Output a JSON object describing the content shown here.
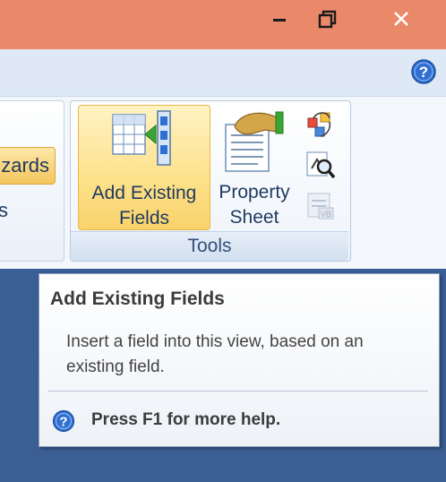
{
  "window": {
    "minimize_icon": "minimize-icon",
    "maximize_icon": "restore-icon",
    "close_icon": "close-icon",
    "titlebar_color": "#e9896a"
  },
  "ribbon": {
    "help_icon": "help-icon",
    "left_group": {
      "wizards_label": "zards",
      "fragment_label": "s"
    },
    "tools_group": {
      "label": "Tools",
      "add_existing_fields": "Add Existing Fields",
      "add_existing_line1": "Add Existing",
      "add_existing_line2": "Fields",
      "property_sheet_line1": "Property",
      "property_sheet_line2": "Sheet",
      "small_icons": [
        "tab-order-icon",
        "view-code-icon",
        "convert-macros-icon"
      ]
    }
  },
  "tooltip": {
    "title": "Add Existing Fields",
    "description": "Insert a field into this view, based on an existing field.",
    "help_text": "Press F1 for more help."
  }
}
